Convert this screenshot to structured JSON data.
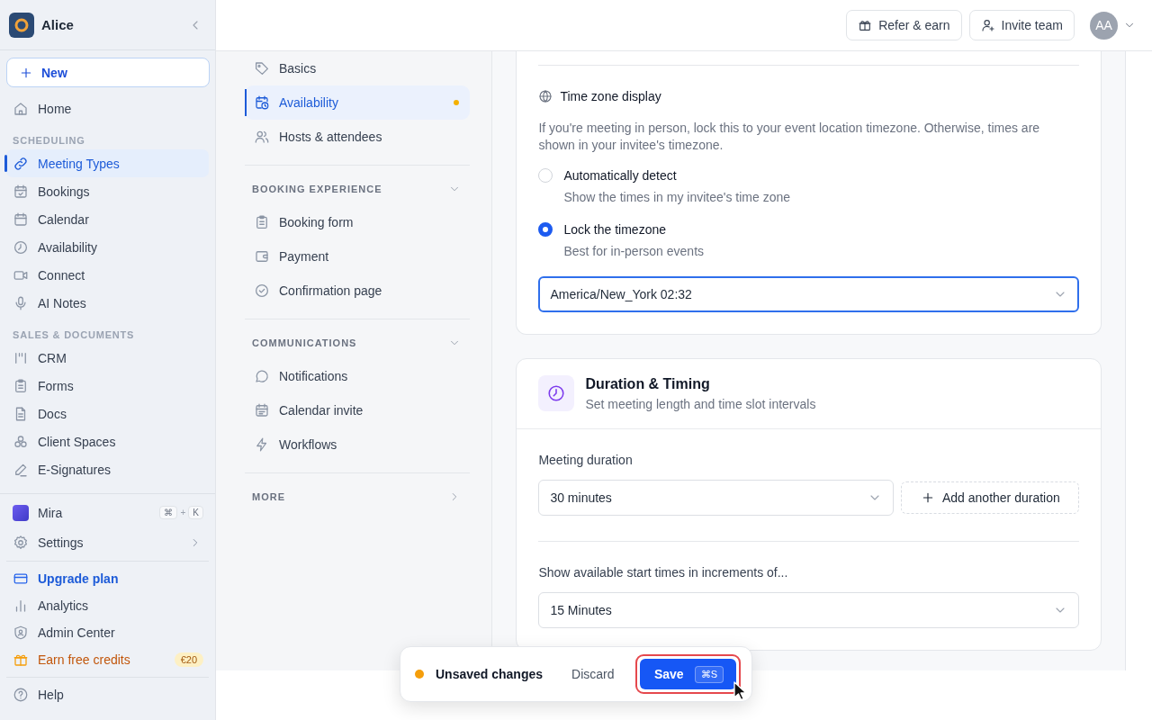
{
  "sidebar": {
    "workspace": "Alice",
    "new_button": "New",
    "sections": [
      {
        "items": [
          {
            "label": "Home",
            "selected": false
          }
        ]
      },
      {
        "heading": "SCHEDULING",
        "items": [
          {
            "label": "Meeting Types",
            "selected": true
          },
          {
            "label": "Bookings",
            "selected": false
          },
          {
            "label": "Calendar",
            "selected": false
          },
          {
            "label": "Availability",
            "selected": false
          },
          {
            "label": "Connect",
            "selected": false
          },
          {
            "label": "AI Notes",
            "selected": false
          }
        ]
      },
      {
        "heading": "SALES & DOCUMENTS",
        "items": [
          {
            "label": "CRM",
            "selected": false
          },
          {
            "label": "Forms",
            "selected": false
          },
          {
            "label": "Docs",
            "selected": false
          },
          {
            "label": "Client Spaces",
            "selected": false
          },
          {
            "label": "E-Signatures",
            "selected": false
          }
        ]
      }
    ],
    "footer_groups": [
      {
        "items": [
          {
            "kind": "assistant",
            "label": "Mira",
            "selected": false,
            "shortcut": [
              "⌘",
              "+",
              "K"
            ]
          },
          {
            "kind": "menu",
            "label": "Settings",
            "selected": false,
            "expanded": false
          }
        ]
      },
      {
        "items": [
          {
            "kind": "upgrade",
            "label": "Upgrade plan",
            "selected": false
          },
          {
            "kind": "plain",
            "label": "Analytics",
            "selected": false
          },
          {
            "kind": "plain",
            "label": "Admin Center",
            "selected": false
          },
          {
            "kind": "reward",
            "label": "Earn free credits",
            "selected": false,
            "badge": "€20"
          }
        ]
      },
      {
        "items": [
          {
            "kind": "plain",
            "label": "Help",
            "selected": false
          }
        ]
      }
    ]
  },
  "topbar": {
    "buttons": [
      {
        "label": "Refer & earn"
      },
      {
        "label": "Invite team"
      }
    ],
    "avatar": "AA"
  },
  "subnav": {
    "groups": [
      {
        "items": [
          {
            "label": "Basics",
            "selected": false,
            "unsaved": false
          },
          {
            "label": "Availability",
            "selected": true,
            "unsaved": true
          },
          {
            "label": "Hosts & attendees",
            "selected": false,
            "unsaved": false
          }
        ]
      },
      {
        "heading": "BOOKING EXPERIENCE",
        "expanded": true,
        "items": [
          {
            "label": "Booking form",
            "selected": false,
            "unsaved": false
          },
          {
            "label": "Payment",
            "selected": false,
            "unsaved": false
          },
          {
            "label": "Confirmation page",
            "selected": false,
            "unsaved": false
          }
        ]
      },
      {
        "heading": "COMMUNICATIONS",
        "expanded": true,
        "items": [
          {
            "label": "Notifications",
            "selected": false,
            "unsaved": false
          },
          {
            "label": "Calendar invite",
            "selected": false,
            "unsaved": false
          },
          {
            "label": "Workflows",
            "selected": false,
            "unsaved": false
          }
        ]
      },
      {
        "heading": "MORE",
        "expanded": false
      }
    ]
  },
  "timezone_card": {
    "title": "Time zone display",
    "description": "If you're meeting in person, lock this to your event location timezone. Otherwise, times are shown in your invitee's timezone.",
    "options": [
      {
        "label": "Automatically detect",
        "description": "Show the times in my invitee's time zone",
        "selected": false
      },
      {
        "label": "Lock the timezone",
        "description": "Best for in-person events",
        "selected": true
      }
    ],
    "select": {
      "value": "America/New_York 02:32",
      "focused": true
    }
  },
  "duration_card": {
    "title": "Duration & Timing",
    "subtitle": "Set meeting length and time slot intervals",
    "duration": {
      "label": "Meeting duration",
      "value": "30 minutes",
      "add_button": "Add another duration"
    },
    "increment": {
      "label": "Show available start times in increments of...",
      "value": "15 Minutes"
    }
  },
  "save_bar": {
    "status": "Unsaved changes",
    "discard": "Discard",
    "save": "Save",
    "shortcut": "⌘S",
    "highlighted": true
  }
}
